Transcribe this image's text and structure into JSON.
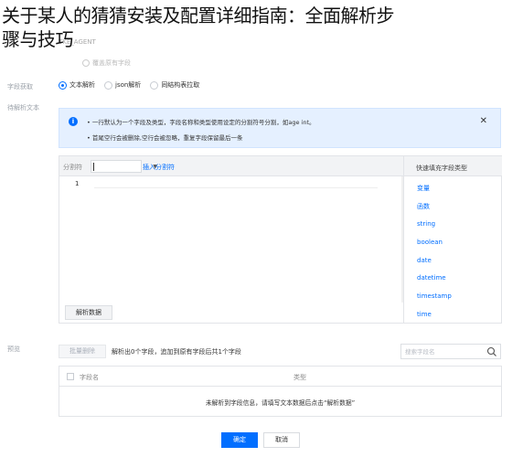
{
  "overlay": {
    "title_line1": "关于某人的猜猜安装及配置详细指南：全面解析步",
    "title_line2": "骤与技巧"
  },
  "header": {
    "agent_name": "TKE_AGENT",
    "top_option_1": "覆盖原有字段"
  },
  "labels": {
    "field_fetch": "字段获取",
    "text_to_parse": "待解析文本",
    "preview": "预览"
  },
  "parse_method": {
    "options": [
      "文本解析",
      "json解析",
      "同结构表拉取"
    ],
    "selected_index": 0
  },
  "info": {
    "line1": "• 一行默认为一个字段及类型，字段名称和类型使用设定的分割符号分割，如age int。",
    "line2": "• 首尾空行会被删除,空行会被忽略，重复字段保留最后一条"
  },
  "editor": {
    "separator_label": "分割符",
    "separator_value": "|",
    "insert_separator": "插入分割符",
    "line_number": "1",
    "parse_button": "解析数据"
  },
  "quick_fill": {
    "title": "快速填充字段类型",
    "items": [
      "变量",
      "函数",
      "string",
      "boolean",
      "date",
      "datetime",
      "timestamp",
      "time"
    ]
  },
  "preview": {
    "overwrite_button": "批量删除",
    "status": "解析出0个字段，追加到原有字段后共1个字段",
    "search_placeholder": "搜索字段名",
    "columns": [
      "字段名",
      "类型"
    ],
    "empty_message": "未解析到字段信息，请填写文本数据后点击“解析数据”"
  },
  "footer": {
    "ok_label": "确定",
    "cancel_label": "取消"
  },
  "colors": {
    "accent": "#006eff",
    "info_bg": "#e5f0ff"
  }
}
